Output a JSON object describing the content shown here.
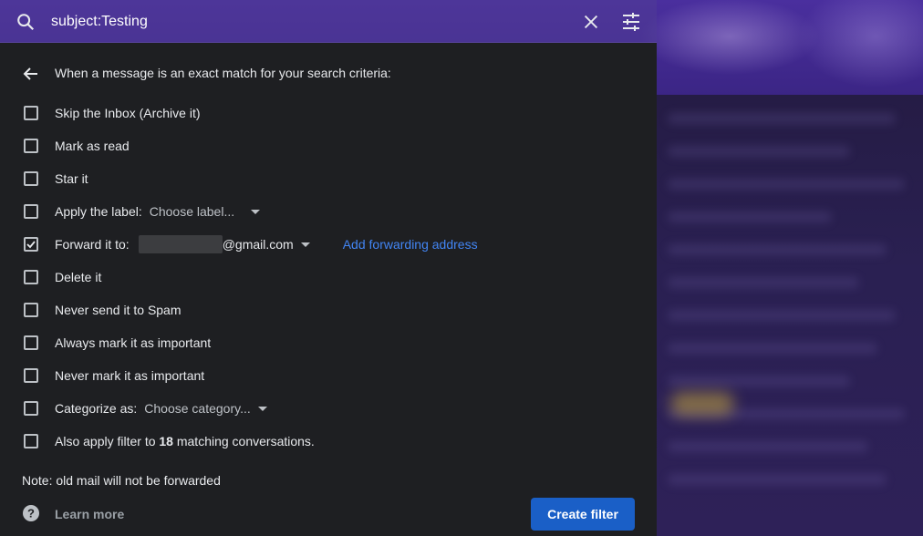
{
  "search": {
    "query": "subject:Testing"
  },
  "panel": {
    "criteria_title": "When a message is an exact match for your search criteria:",
    "options": [
      {
        "label": "Skip the Inbox (Archive it)",
        "checked": false
      },
      {
        "label": "Mark as read",
        "checked": false
      },
      {
        "label": "Star it",
        "checked": false
      },
      {
        "label": "Apply the label:",
        "checked": false,
        "dropdown": "Choose label..."
      },
      {
        "label": "Forward it to:",
        "checked": true,
        "email_domain": "@gmail.com",
        "link": "Add forwarding address"
      },
      {
        "label": "Delete it",
        "checked": false
      },
      {
        "label": "Never send it to Spam",
        "checked": false
      },
      {
        "label": "Always mark it as important",
        "checked": false
      },
      {
        "label": "Never mark it as important",
        "checked": false
      },
      {
        "label": "Categorize as:",
        "checked": false,
        "dropdown": "Choose category..."
      },
      {
        "label_prefix": "Also apply filter to ",
        "count": "18",
        "label_suffix": " matching conversations.",
        "checked": false
      }
    ],
    "note": "Note: old mail will not be forwarded",
    "learn_more": "Learn more",
    "create_filter": "Create filter"
  },
  "icons": {
    "search": "search-icon",
    "close": "close-icon",
    "tune": "tune-icon",
    "back": "arrow-back-icon",
    "help": "help-icon",
    "check": "checkmark-icon"
  },
  "colors": {
    "panel_bg": "#1e1f22",
    "accent_button": "#1a5fc7",
    "link": "#4285f4",
    "text": "#e8eaed"
  }
}
